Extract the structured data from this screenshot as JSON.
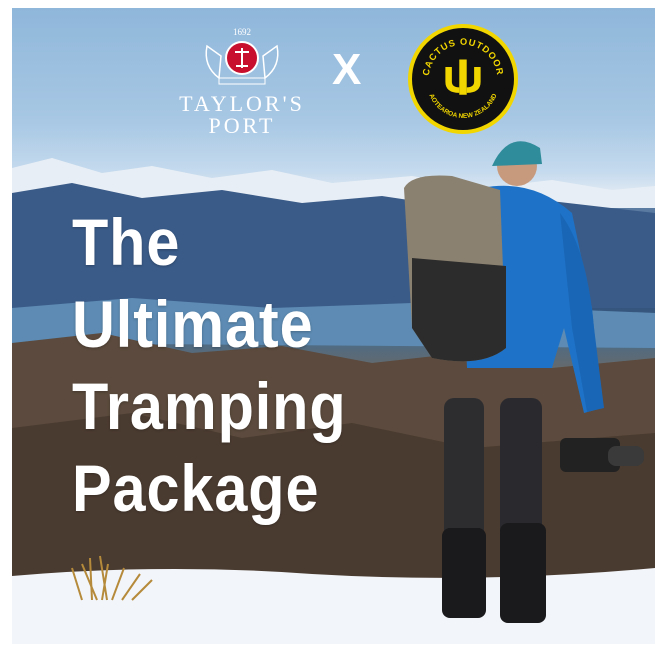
{
  "logos": {
    "left_year": "1692",
    "left_brand_line1": "TAYLOR'S",
    "left_brand_line2": "PORT",
    "separator": "X",
    "right_badge_top": "CACTUS OUTDOOR",
    "right_badge_bottom": "AOTEAROA NEW ZEALAND"
  },
  "headline": {
    "line1": "The",
    "line2": "Ultimate",
    "line3": "Tramping",
    "line4": "Package"
  },
  "colors": {
    "sky": "#a8c8e4",
    "mountains": "#3d5f8c",
    "snow": "#f1f4f8",
    "badge_yellow": "#f2d600",
    "jacket_blue": "#1e73c8",
    "crest_red": "#c8102e"
  }
}
